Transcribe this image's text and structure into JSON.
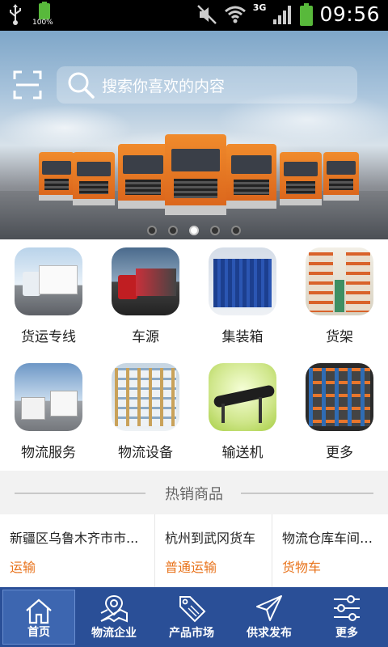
{
  "status_bar": {
    "battery_small_percent": "100%",
    "network": "3G",
    "time": "09:56",
    "icons": [
      "usb-icon",
      "battery-icon",
      "mute-icon",
      "wifi-icon",
      "signal-icon",
      "battery-icon"
    ]
  },
  "banner": {
    "search_placeholder": "搜索你喜欢的内容",
    "slide_count": 5,
    "active_slide": 3
  },
  "categories": [
    {
      "label": "货运专线",
      "icon": "truck-white-icon"
    },
    {
      "label": "车源",
      "icon": "truck-red-icon"
    },
    {
      "label": "集装箱",
      "icon": "container-icon"
    },
    {
      "label": "货架",
      "icon": "warehouse-shelf-icon"
    },
    {
      "label": "物流服务",
      "icon": "trucks-fleet-icon"
    },
    {
      "label": "物流设备",
      "icon": "storage-rack-icon"
    },
    {
      "label": "输送机",
      "icon": "conveyor-icon"
    },
    {
      "label": "更多",
      "icon": "pallet-rack-icon"
    }
  ],
  "hot": {
    "title": "热销商品",
    "items": [
      {
        "name": "新疆区乌鲁木齐市市...",
        "category": "运输"
      },
      {
        "name": "杭州到武冈货车",
        "category": "普通运输"
      },
      {
        "name": "物流仓库车间防...",
        "category": "货物车"
      }
    ]
  },
  "bottom_nav": [
    {
      "label": "首页",
      "icon": "home-icon",
      "active": true
    },
    {
      "label": "物流企业",
      "icon": "map-location-icon",
      "active": false
    },
    {
      "label": "产品市场",
      "icon": "sale-tag-icon",
      "active": false
    },
    {
      "label": "供求发布",
      "icon": "send-icon",
      "active": false
    },
    {
      "label": "更多",
      "icon": "settings-sliders-icon",
      "active": false
    }
  ],
  "colors": {
    "accent_orange": "#e8731c",
    "nav_blue": "#2a4f97"
  }
}
